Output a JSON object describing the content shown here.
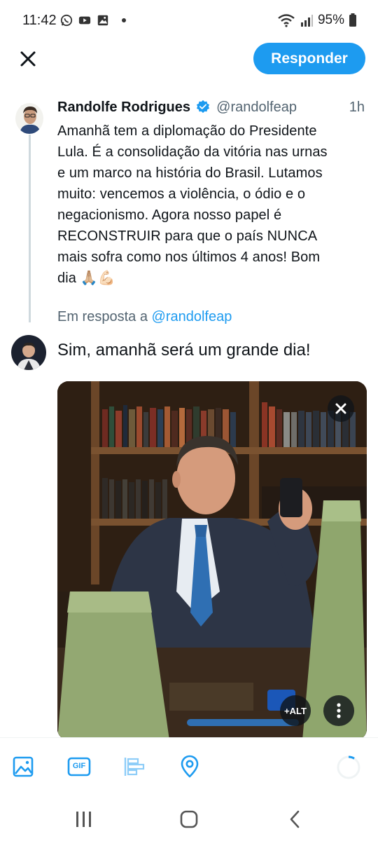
{
  "status_bar": {
    "time": "11:42",
    "battery": "95%",
    "icons": [
      "whatsapp-icon",
      "youtube-icon",
      "gallery-icon",
      "notification-dot",
      "wifi-icon",
      "signal-icon",
      "battery-icon"
    ]
  },
  "header": {
    "reply_button_label": "Responder",
    "close_icon": "close-icon"
  },
  "original_tweet": {
    "author_name": "Randolfe Rodrigues",
    "author_handle": "@randolfeap",
    "time_ago": "1h",
    "verified": true,
    "text_lines": [
      "Amanhã tem a diplomação do Presidente",
      "Lula. É a consolidação da vitória nas urnas",
      "e um marco na história do Brasil. Lutamos",
      "muito: vencemos a violência, o ódio e o",
      "negacionismo. Agora nosso papel é",
      "RECONSTRUIR para que o país NUNCA",
      "mais sofra como nos últimos 4 anos! Bom",
      "dia 🙏🏼💪🏻"
    ]
  },
  "reply": {
    "replying_to_prefix": "Em resposta a",
    "replying_to_handle": "@randolfeap",
    "text": "Sim, amanhã será um grande dia!",
    "attachment": {
      "alt_label": "+ALT",
      "remove_icon": "close-icon",
      "more_icon": "more-vertical-icon"
    }
  },
  "toolbar": {
    "items": [
      "image-icon",
      "gif-icon",
      "poll-icon",
      "location-icon",
      "character-counter"
    ],
    "gif_label": "GIF"
  },
  "navbar": {
    "items": [
      "recent-apps-icon",
      "home-icon",
      "back-icon"
    ]
  },
  "colors": {
    "accent": "#1d9bf0",
    "text": "#0f1419",
    "secondary": "#536471",
    "thread_line": "#cfd9de"
  }
}
